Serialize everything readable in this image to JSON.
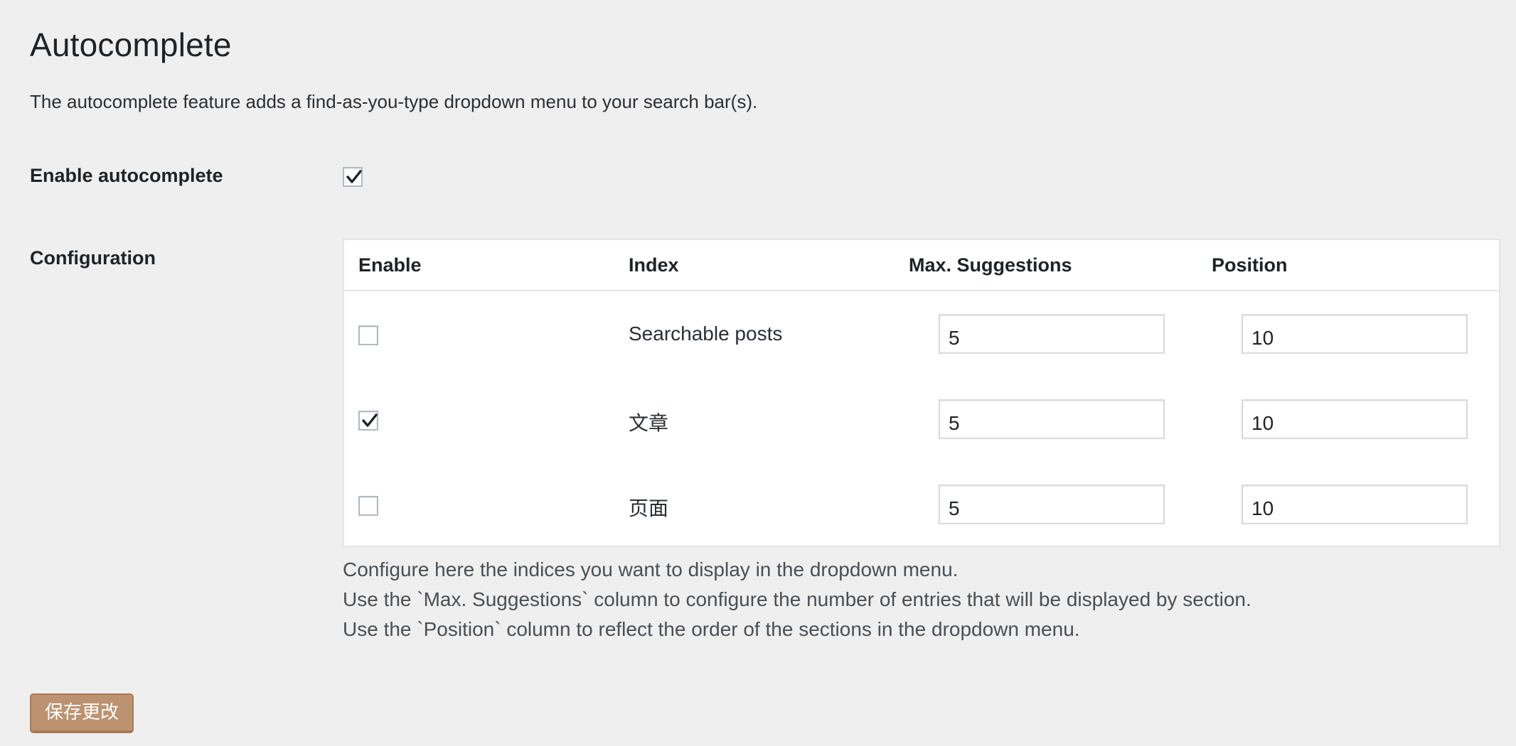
{
  "page": {
    "title": "Autocomplete",
    "description": "The autocomplete feature adds a find-as-you-type dropdown menu to your search bar(s)."
  },
  "enable_autocomplete": {
    "label": "Enable autocomplete",
    "checked": true
  },
  "configuration": {
    "label": "Configuration",
    "headers": {
      "enable": "Enable",
      "index": "Index",
      "max_suggestions": "Max. Suggestions",
      "position": "Position"
    },
    "rows": [
      {
        "enabled": false,
        "index": "Searchable posts",
        "max_suggestions": "5",
        "position": "10"
      },
      {
        "enabled": true,
        "index": "文章",
        "max_suggestions": "5",
        "position": "10"
      },
      {
        "enabled": false,
        "index": "页面",
        "max_suggestions": "5",
        "position": "10"
      }
    ],
    "help": [
      "Configure here the indices you want to display in the dropdown menu.",
      "Use the `Max. Suggestions` column to configure the number of entries that will be displayed by section.",
      "Use the `Position` column to reflect the order of the sections in the dropdown menu."
    ]
  },
  "save_button": {
    "label": "保存更改"
  },
  "colors": {
    "background": "#efefef",
    "button": "#bd9271",
    "border": "#e2e4e7"
  }
}
